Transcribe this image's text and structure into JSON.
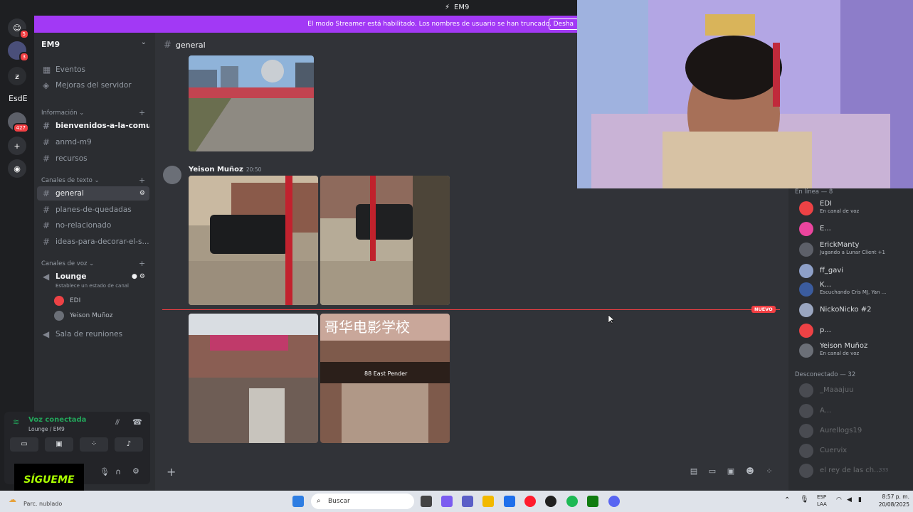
{
  "topbar": {
    "server_tag": "EM9"
  },
  "banner": {
    "message": "El modo Streamer está habilitado. Los nombres de usuario se han truncado.",
    "button": "Desha"
  },
  "rail": {
    "badges": [
      "5",
      "3",
      "427"
    ],
    "esde_label": "EsdE"
  },
  "sidebar": {
    "server_name": "EM9",
    "top_items": [
      "Eventos",
      "Mejoras del servidor"
    ],
    "info_category": "Información",
    "info_channels": [
      "bienvenidos-a-la-comun...",
      "anmd-m9",
      "recursos"
    ],
    "text_category": "Canales de texto",
    "text_channels": [
      "general",
      "planes-de-quedadas",
      "no-relacionado",
      "ideas-para-decorar-el-s..."
    ],
    "voice_category": "Canales de voz",
    "voice_channel": "Lounge",
    "voice_status": "Establece un estado de canal",
    "voice_users": [
      "EDI",
      "Yeison Muñoz"
    ],
    "voice_channel_2": "Sala de reuniones"
  },
  "voice_panel": {
    "status": "Voz conectada",
    "channel": "Lounge / EM9"
  },
  "overlay": {
    "sigueme": "SÍGUEME"
  },
  "chat": {
    "channel": "general",
    "author": "Yeison Muñoz",
    "time": "20:50",
    "new_tag": "NUEVO",
    "sign_text": "88 East Pender",
    "chinese_sign": "哥华电影学校"
  },
  "members": {
    "online_header": "En línea — 8",
    "online": [
      {
        "name": "EDI",
        "status": "En canal de voz",
        "color": "#ed4245"
      },
      {
        "name": "E...",
        "status": "",
        "color": "#eb459e"
      },
      {
        "name": "ErickManty",
        "status": "Jugando a Lunar Client +1",
        "color": "#5d6069"
      },
      {
        "name": "ff_gavi",
        "status": "",
        "color": "#8ea0c8"
      },
      {
        "name": "K...",
        "status": "Escuchando Cris MJ, Yan ...",
        "color": "#3b5c9e"
      },
      {
        "name": "NickoNicko #2",
        "status": "",
        "color": "#9aa6c0"
      },
      {
        "name": "p...",
        "status": "",
        "color": "#ed4245"
      },
      {
        "name": "Yeison Muñoz",
        "status": "En canal de voz",
        "color": "#6b6f77"
      }
    ],
    "offline_header": "Desconectado — 32",
    "offline": [
      "_Maaajuu",
      "A...",
      "Aurellogs19",
      "Cuervix",
      "el rey de las ch..."
    ],
    "offline_extra": "333"
  },
  "taskbar": {
    "weather": "Parc. nublado",
    "search_placeholder": "Buscar",
    "lang1": "ESP",
    "lang2": "LAA",
    "time": "8:57 p. m.",
    "date": "20/08/2025"
  }
}
